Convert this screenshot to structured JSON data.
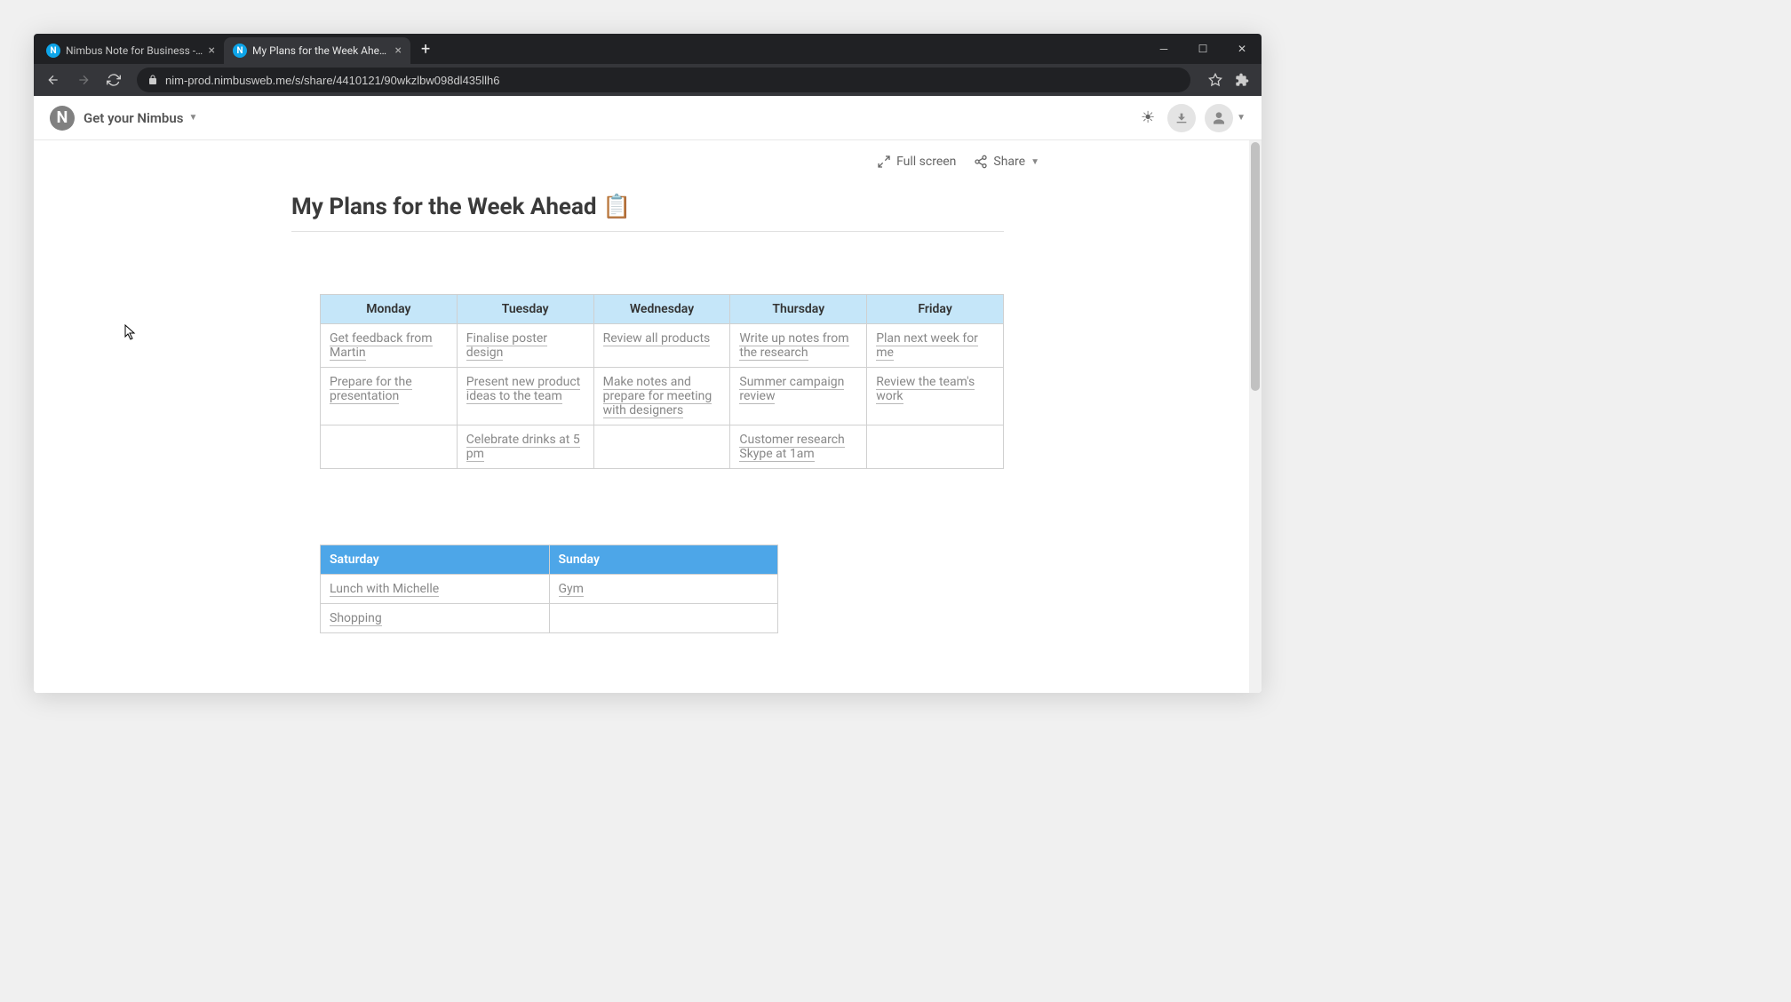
{
  "browser": {
    "tabs": [
      {
        "title": "Nimbus Note for Business - Org",
        "active": false
      },
      {
        "title": "My Plans for the Week Ahead 📋",
        "active": true
      }
    ],
    "url": "nim-prod.nimbusweb.me/s/share/4410121/90wkzlbw098dl435llh6"
  },
  "app": {
    "brand": "Get your Nimbus",
    "actions": {
      "fullscreen": "Full screen",
      "share": "Share"
    }
  },
  "document": {
    "title": "My Plans for the Week Ahead 📋",
    "weekdays": {
      "headers": [
        "Monday",
        "Tuesday",
        "Wednesday",
        "Thursday",
        "Friday"
      ],
      "rows": [
        [
          "Get feedback from Martin",
          "Finalise poster design",
          "Review all products",
          "Write up notes from the research",
          "Plan next week for me"
        ],
        [
          "Prepare for the presentation",
          "Present new product ideas to the team",
          "Make notes and prepare for meeting with designers",
          "Summer campaign review",
          "Review the team's work"
        ],
        [
          "",
          "Celebrate drinks at 5 pm",
          "",
          "Customer research Skype at 1am",
          ""
        ]
      ]
    },
    "weekend": {
      "headers": [
        "Saturday",
        "Sunday"
      ],
      "rows": [
        [
          "Lunch with Michelle",
          "Gym"
        ],
        [
          "Shopping",
          ""
        ]
      ]
    }
  }
}
